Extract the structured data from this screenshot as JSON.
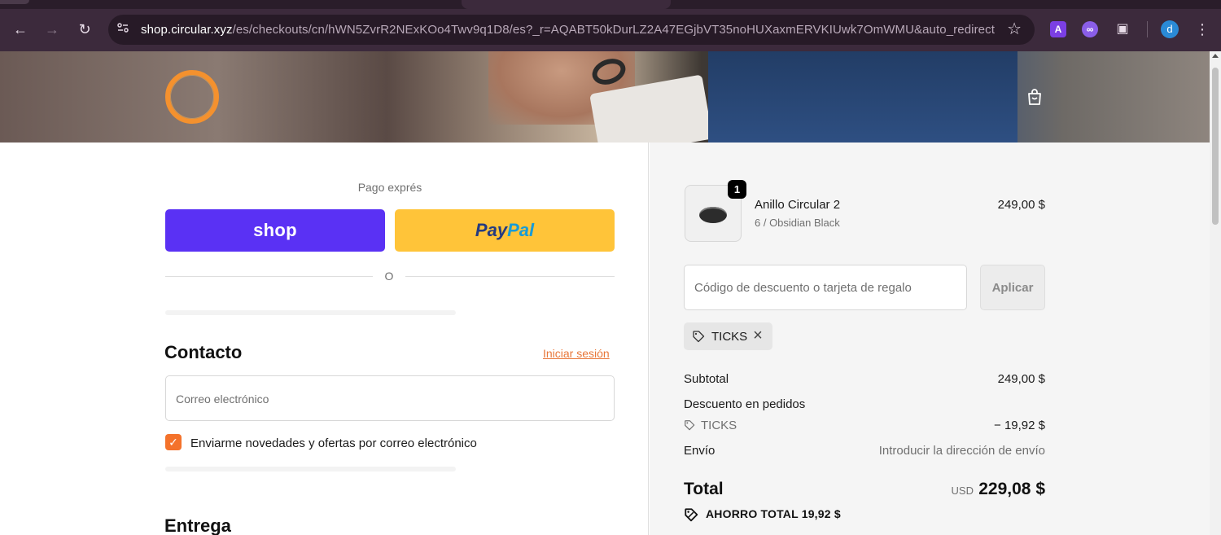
{
  "browser": {
    "url_host": "shop.circular.xyz",
    "url_rest": "/es/checkouts/cn/hWN5ZvrR2NExKOo4Twv9q1D8/es?_r=AQABT50kDurLZ2A47EGjbVT35noHUXaxmERVKIUwk7OmWMU&auto_redirect...",
    "profile_initial": "d",
    "ext_a_label": "A"
  },
  "checkout": {
    "express_label": "Pago exprés",
    "shop_pay_label": "shop",
    "paypal_pay": "Pay",
    "paypal_pal": "Pal",
    "or_label": "O",
    "contact_heading": "Contacto",
    "login_link": "Iniciar sesión",
    "email_placeholder": "Correo electrónico",
    "newsletter_label": "Enviarme novedades y ofertas por correo electrónico",
    "newsletter_checked": true,
    "delivery_heading": "Entrega"
  },
  "summary": {
    "product": {
      "quantity": "1",
      "name": "Anillo Circular 2",
      "variant": "6 / Obsidian Black",
      "price": "249,00 $"
    },
    "discount_placeholder": "Código de descuento o tarjeta de regalo",
    "apply_label": "Aplicar",
    "applied_code": "TICKS",
    "subtotal_label": "Subtotal",
    "subtotal_value": "249,00 $",
    "order_discount_label": "Descuento en pedidos",
    "discount_code": "TICKS",
    "discount_value": "− 19,92 $",
    "shipping_label": "Envío",
    "shipping_value": "Introducir la dirección de envío",
    "total_label": "Total",
    "total_currency": "USD",
    "total_value": "229,08 $",
    "savings_text": "AHORRO TOTAL  19,92 $"
  },
  "colors": {
    "shop_pay": "#5a31f4",
    "paypal": "#ffc439",
    "accent": "#f4722b",
    "logo_ring": "#f4912e"
  }
}
